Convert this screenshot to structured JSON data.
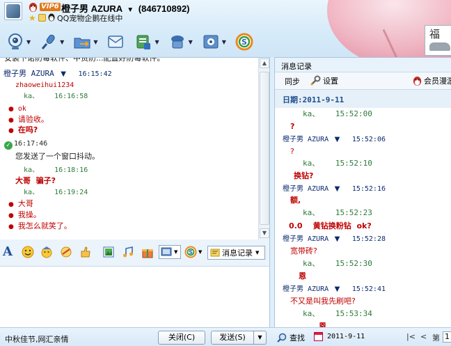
{
  "header": {
    "vip_badge": "VIP6",
    "contact_name": "橙子男 AZURA",
    "name_arrow": "▼",
    "contact_qq": "(846710892)",
    "status_text": "QQ宠物企鹅在线中",
    "star": "★"
  },
  "promo": {
    "text": "福"
  },
  "toolbar": {
    "dropdown_glyph": "▼",
    "items": [
      {
        "name": "video-call",
        "icon": "webcam-icon"
      },
      {
        "name": "voice-call",
        "icon": "microphone-icon"
      },
      {
        "name": "send-file",
        "icon": "folder-icon"
      },
      {
        "name": "send-sms",
        "icon": "sms-icon"
      },
      {
        "name": "create-group",
        "icon": "group-icon"
      },
      {
        "name": "remote-assist",
        "icon": "remote-icon"
      },
      {
        "name": "apps",
        "icon": "apps-icon"
      },
      {
        "name": "soso",
        "icon": "soso-icon"
      }
    ]
  },
  "chat": {
    "top_partial": "安装下诺防毒软件、中贸防...配置好防毒软件。",
    "messages": [
      {
        "sender": "橙子男 AZURA",
        "arrow": "▼",
        "time": "16:15:42"
      },
      {
        "sender": "zhaoweihui1234"
      },
      {
        "sender": "ka、",
        "time": "16:16:58"
      },
      {
        "text": "ok"
      },
      {
        "text": "请验收。"
      },
      {
        "text": "在吗?"
      },
      {
        "time": "16:17:46"
      },
      {
        "text": "您发送了一个窗口抖动。"
      },
      {
        "sender": "ka、",
        "time": "16:18:16"
      },
      {
        "text": "大哥  骗子?"
      },
      {
        "sender": "ka、",
        "time": "16:19:24"
      },
      {
        "text": "大哥"
      },
      {
        "text": "我操。"
      },
      {
        "text": "我怎么就笑了。"
      }
    ]
  },
  "scroll": {
    "up": "▲",
    "down": "▼"
  },
  "input_toolbar": {
    "font_label": "A",
    "msg_record_label": "消息记录",
    "dropdown_glyph": "▼"
  },
  "history": {
    "title": "消息记录",
    "sync_label": "同步",
    "settings_label": "设置",
    "member_label": "会员漫游",
    "date_label": "日期:2011-9-11",
    "entries": [
      {
        "sender": "ka、",
        "time": "15:52:00"
      },
      {
        "text": "?"
      },
      {
        "sender": "橙子男 AZURA",
        "arrow": "▼",
        "time": "15:52:06"
      },
      {
        "text": "?"
      },
      {
        "sender": "ka、",
        "time": "15:52:10"
      },
      {
        "text": "换钻?"
      },
      {
        "sender": "橙子男 AZURA",
        "arrow": "▼",
        "time": "15:52:16"
      },
      {
        "text": "额,"
      },
      {
        "sender": "ka、",
        "time": "15:52:23"
      },
      {
        "text": "0.0    黄钻换粉钻  ok?"
      },
      {
        "sender": "橙子男 AZURA",
        "arrow": "▼",
        "time": "15:52:28"
      },
      {
        "text": "宽带砖?"
      },
      {
        "sender": "ka、",
        "time": "15:52:30"
      },
      {
        "text": "恩"
      },
      {
        "sender": "橙子男 AZURA",
        "arrow": "▼",
        "time": "15:52:41"
      },
      {
        "text": "不又是叫我先刷吧?"
      },
      {
        "sender": "ka、",
        "time": "15:53:34"
      },
      {
        "text": "恩"
      }
    ]
  },
  "bottom": {
    "ad_text": "中秋佳节,网汇亲情",
    "close_label": "关闭(C)",
    "send_label": "发送(S)",
    "send_dropdown": "▼",
    "search_label": "查找",
    "date_value": "2011-9-11",
    "first_page": "|<",
    "prev_page": "<",
    "page_prefix": "第",
    "page_value": "1"
  },
  "colors": {
    "sender": "#0a2a6e",
    "timestamp": "#2b7a3a",
    "message_red": "#c00000",
    "panel_bg": "#dfeefa"
  }
}
